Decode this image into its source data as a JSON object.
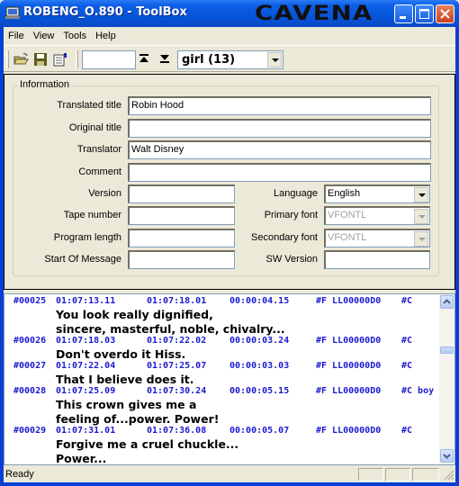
{
  "window": {
    "title": "ROBENG_O.890 - ToolBox",
    "brand": "CAVENA"
  },
  "menu": [
    "File",
    "View",
    "Tools",
    "Help"
  ],
  "toolbar": {
    "search_value": "",
    "speaker_combo": "girl (13)"
  },
  "info": {
    "group_label": "Information",
    "translated_title": {
      "label": "Translated title",
      "value": "Robin Hood"
    },
    "original_title": {
      "label": "Original title",
      "value": ""
    },
    "translator": {
      "label": "Translator",
      "value": "Walt Disney"
    },
    "comment": {
      "label": "Comment",
      "value": ""
    },
    "version": {
      "label": "Version",
      "value": ""
    },
    "tape_number": {
      "label": "Tape number",
      "value": ""
    },
    "program_length": {
      "label": "Program length",
      "value": ""
    },
    "start_of_message": {
      "label": "Start Of Message",
      "value": ""
    },
    "language": {
      "label": "Language",
      "value": "English"
    },
    "primary_font": {
      "label": "Primary font",
      "value": "VFONTL"
    },
    "secondary_font": {
      "label": "Secondary font",
      "value": "VFONTL"
    },
    "sw_version": {
      "label": "SW Version",
      "value": ""
    }
  },
  "subtitles": [
    {
      "id": "#00025",
      "in": "01:07:13.11",
      "out": "01:07:18.01",
      "dur": "00:00:04.15",
      "font": "#F LL00000D0",
      "tag": "#C",
      "lines": [
        "You look really dignified,",
        "sincere, masterful, noble, chivalry..."
      ]
    },
    {
      "id": "#00026",
      "in": "01:07:18.03",
      "out": "01:07:22.02",
      "dur": "00:00:03.24",
      "font": "#F LL00000D0",
      "tag": "#C",
      "lines": [
        "Don't overdo it Hiss."
      ]
    },
    {
      "id": "#00027",
      "in": "01:07:22.04",
      "out": "01:07:25.07",
      "dur": "00:00:03.03",
      "font": "#F LL00000D0",
      "tag": "#C",
      "lines": [
        "That I believe does it."
      ]
    },
    {
      "id": "#00028",
      "in": "01:07:25.09",
      "out": "01:07:30.24",
      "dur": "00:00:05.15",
      "font": "#F LL00000D0",
      "tag": "#C boy",
      "lines": [
        "This crown gives me a",
        "feeling of...power. Power!"
      ]
    },
    {
      "id": "#00029",
      "in": "01:07:31.01",
      "out": "01:07:36.08",
      "dur": "00:00:05.07",
      "font": "#F LL00000D0",
      "tag": "#C",
      "lines": [
        "Forgive me a cruel chuckle...",
        "Power..."
      ]
    }
  ],
  "status": {
    "text": "Ready"
  }
}
